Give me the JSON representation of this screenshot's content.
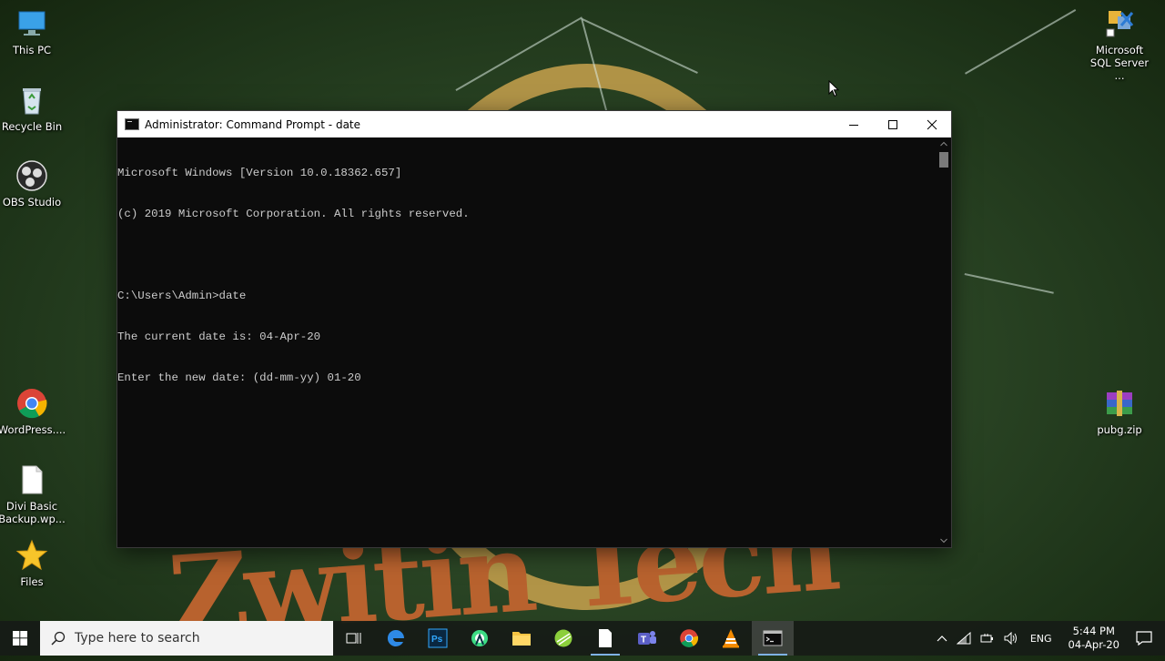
{
  "desktop": {
    "icons_left": [
      {
        "label": "This PC",
        "icon": "this-pc-icon"
      },
      {
        "label": "Recycle Bin",
        "icon": "recycle-bin-icon"
      },
      {
        "label": "OBS Studio",
        "icon": "obs-icon"
      },
      {
        "label": "WordPress....",
        "icon": "chrome-icon"
      },
      {
        "label": "Divi Basic Backup.wp...",
        "icon": "file-icon"
      },
      {
        "label": "Files",
        "icon": "star-icon"
      }
    ],
    "icons_right": [
      {
        "label": "Microsoft SQL Server ...",
        "icon": "sql-server-icon"
      },
      {
        "label": "pubg.zip",
        "icon": "winrar-icon"
      }
    ]
  },
  "window": {
    "title": "Administrator: Command Prompt - date",
    "console_lines": [
      "Microsoft Windows [Version 10.0.18362.657]",
      "(c) 2019 Microsoft Corporation. All rights reserved.",
      "",
      "C:\\Users\\Admin>date",
      "The current date is: 04-Apr-20",
      "Enter the new date: (dd-mm-yy) 01-20"
    ]
  },
  "taskbar": {
    "search_placeholder": "Type here to search",
    "apps": [
      "task-view",
      "edge",
      "photoshop",
      "android-studio",
      "file-explorer",
      "greenshot",
      "notepad",
      "teams",
      "chrome",
      "vlc",
      "command-prompt"
    ],
    "tray": {
      "language": "ENG",
      "time": "5:44 PM",
      "date": "04-Apr-20"
    }
  },
  "colors": {
    "console_bg": "#0c0c0c",
    "console_text": "#cccccc",
    "taskbar_accent": "#7fb2e5"
  }
}
